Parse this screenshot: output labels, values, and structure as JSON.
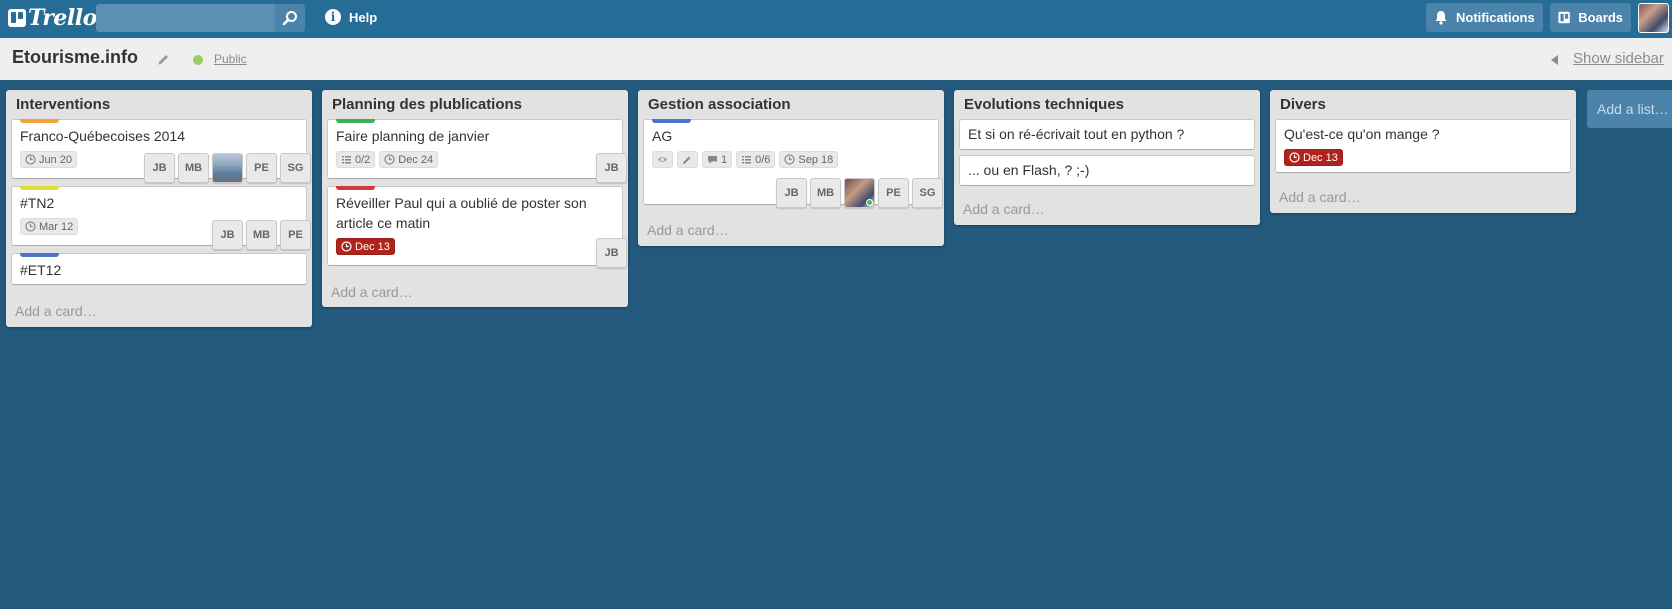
{
  "header": {
    "logo_text": "Trello",
    "search": {
      "value": "",
      "placeholder": ""
    },
    "help_label": "Help",
    "notifications_label": "Notifications",
    "boards_label": "Boards"
  },
  "board": {
    "title": "Etourisme.info",
    "visibility": "Public",
    "show_sidebar_label": "Show sidebar"
  },
  "lists": [
    {
      "title": "Interventions",
      "add_card": "Add a card…",
      "cards": [
        {
          "label_color": "#f2a33a",
          "title": "Franco-Québecoises 2014",
          "due": "Jun 20",
          "members": [
            "JB",
            "MB",
            "",
            "PE",
            "SG"
          ]
        },
        {
          "label_color": "#e3dc34",
          "title": "#TN2",
          "due": "Mar 12",
          "members": [
            "JB",
            "MB",
            "PE"
          ]
        },
        {
          "label_color": "#4a74c9",
          "title": "#ET12"
        }
      ]
    },
    {
      "title": "Planning des plublications",
      "add_card": "Add a card…",
      "cards": [
        {
          "label_color": "#3cb054",
          "title": "Faire planning de janvier",
          "checklist": "0/2",
          "due": "Dec 24",
          "members": [
            "JB"
          ]
        },
        {
          "label_color": "#d03a3a",
          "title_line1": "Réveiller Paul qui a oublié de poster son",
          "title_line2": "article ce matin",
          "due": "Dec 13",
          "members": [
            "JB"
          ]
        }
      ]
    },
    {
      "title": "Gestion association",
      "add_card": "Add a card…",
      "cards": [
        {
          "label_color": "#4a74c9",
          "title": "AG",
          "comments": "1",
          "checklist": "0/6",
          "due": "Sep 18",
          "members": [
            "JB",
            "MB",
            "",
            "PE",
            "SG"
          ]
        }
      ]
    },
    {
      "title": "Evolutions techniques",
      "add_card": "Add a card…",
      "cards": [
        {
          "title": "Et si on ré-écrivait tout en python ?"
        },
        {
          "title": "... ou en Flash, ? ;-)"
        }
      ]
    },
    {
      "title": "Divers",
      "add_card": "Add a card…",
      "cards": [
        {
          "title": "Qu'est-ce qu'on mange ?",
          "due": "Dec 13"
        }
      ]
    }
  ],
  "add_list_label": "Add a list…",
  "colors": {
    "header": "#256d97",
    "board_background": "#23597c",
    "due_overdue": "#b0221c",
    "public_dot": "#9acd5d"
  }
}
